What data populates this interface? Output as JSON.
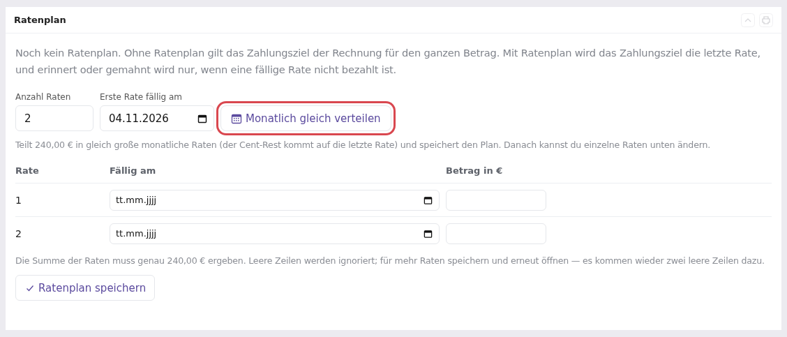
{
  "card": {
    "title": "Ratenplan"
  },
  "intro": "Noch kein Ratenplan. Ohne Ratenplan gilt das Zahlungsziel der Rechnung für den ganzen Betrag. Mit Ratenplan wird das Zahlungsziel die letzte Rate, und erinnert oder gemahnt wird nur, wenn eine fällige Rate nicht bezahlt ist.",
  "count_field": {
    "label": "Anzahl Raten",
    "value": "2"
  },
  "first_due_field": {
    "label": "Erste Rate fällig am",
    "value": "04.11.2026"
  },
  "distribute_button": {
    "label": "Monatlich gleich verteilen",
    "highlighted": true
  },
  "distribute_hint": "Teilt 240,00 € in gleich große monatliche Raten (der Cent-Rest kommt auf die letzte Rate) und speichert den Plan. Danach kannst du einzelne Raten unten ändern.",
  "table": {
    "columns": [
      "Rate",
      "Fällig am",
      "Betrag in €"
    ],
    "rows": [
      {
        "rate": "1",
        "due_placeholder": "tt.mm.jjjj"
      },
      {
        "rate": "2",
        "due_placeholder": "tt.mm.jjjj"
      }
    ]
  },
  "sum_hint": "Die Summe der Raten muss genau 240,00 € ergeben. Leere Zeilen werden ignoriert; für mehr Raten speichern und erneut öffnen — es kommen wieder zwei leere Zeilen dazu.",
  "save_button": {
    "label": "Ratenplan speichern"
  }
}
